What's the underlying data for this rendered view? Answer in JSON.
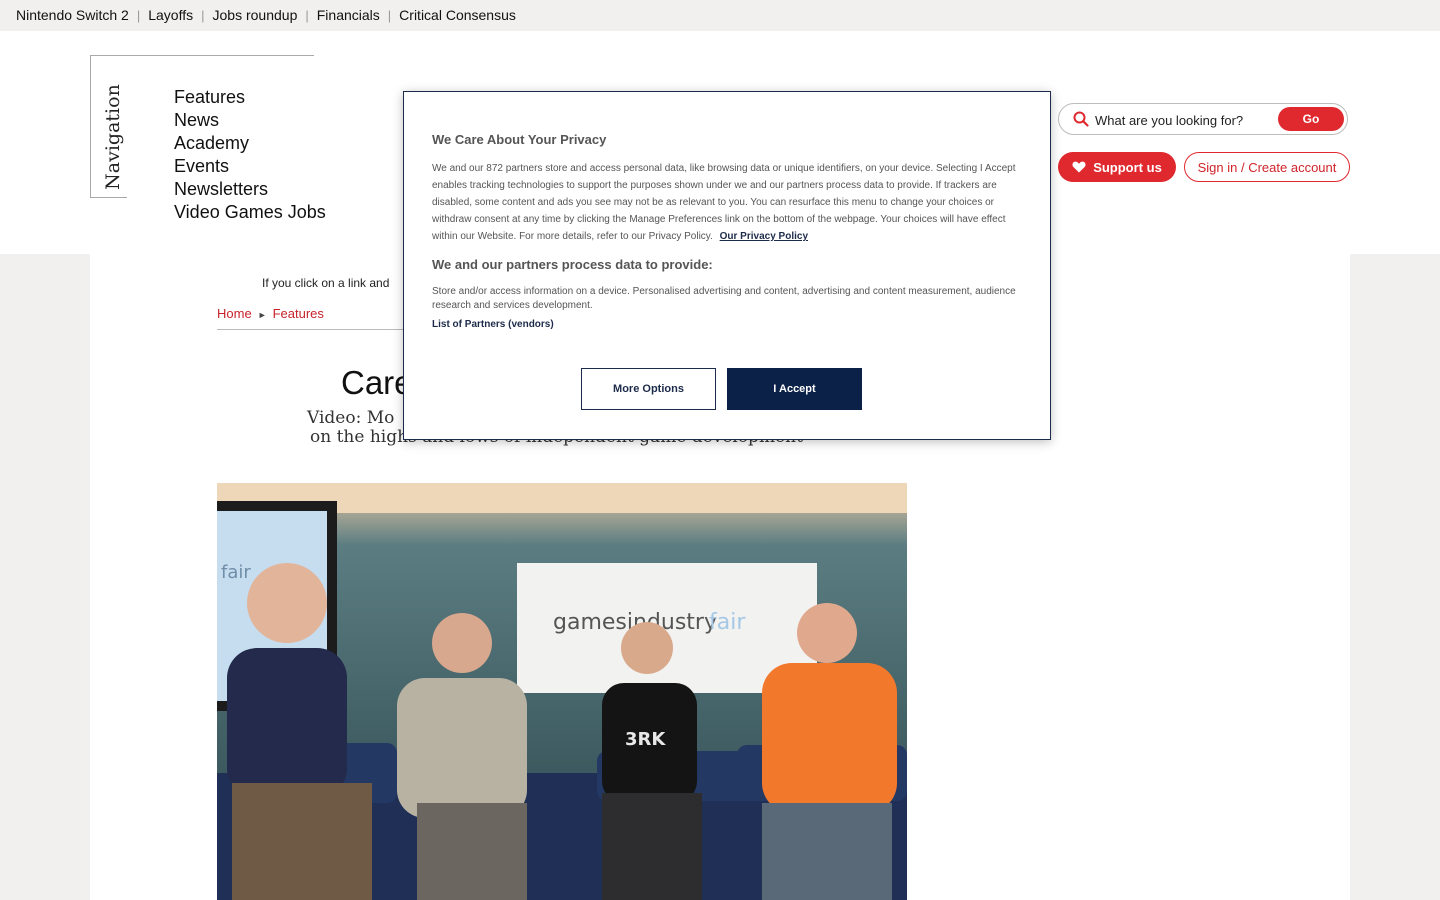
{
  "topnav": {
    "items": [
      "Nintendo Switch 2",
      "Layoffs",
      "Jobs roundup",
      "Financials",
      "Critical Consensus"
    ]
  },
  "sidebar_nav": {
    "label": "Navigation",
    "items": [
      "Features",
      "News",
      "Academy",
      "Events",
      "Newsletters",
      "Video Games Jobs"
    ]
  },
  "search": {
    "placeholder": "What are you looking for?",
    "go_label": "Go"
  },
  "account": {
    "support_label": "Support us",
    "signin_label": "Sign in / Create account"
  },
  "article": {
    "disclaimer": "If you click on a link and",
    "breadcrumb": [
      "Home",
      "Features"
    ],
    "title_visible": "Care",
    "subtitle_line1_visible": "Video: Mo",
    "subtitle_line2_visible": "on the highs and lows of independent game development",
    "hero_sign_text": "gamesindustry",
    "hero_sign_suffix": "fair",
    "hero_screen_text": "fair",
    "hero_shirt_text": "3RK"
  },
  "consent": {
    "title": "We Care About Your Privacy",
    "body": "We and our 872 partners store and access personal data, like browsing data or unique identifiers, on your device. Selecting I Accept enables tracking technologies to support the purposes shown under we and our partners process data to provide. If trackers are disabled, some content and ads you see may not be as relevant to you. You can resurface this menu to change your choices or withdraw consent at any time by clicking the Manage Preferences link on the bottom of the webpage. Your choices will have effect within our Website. For more details, refer to our Privacy Policy.",
    "privacy_link": "Our Privacy Policy",
    "subtitle": "We and our partners process data to provide:",
    "purposes": "Store and/or access information on a device. Personalised advertising and content, advertising and content measurement, audience research and services development.",
    "partners_link": "List of Partners (vendors)",
    "more_options": "More Options",
    "accept": "I Accept"
  },
  "colors": {
    "brand_red": "#e0282f",
    "consent_navy": "#0c2148",
    "page_bg": "#f1f0ee"
  }
}
